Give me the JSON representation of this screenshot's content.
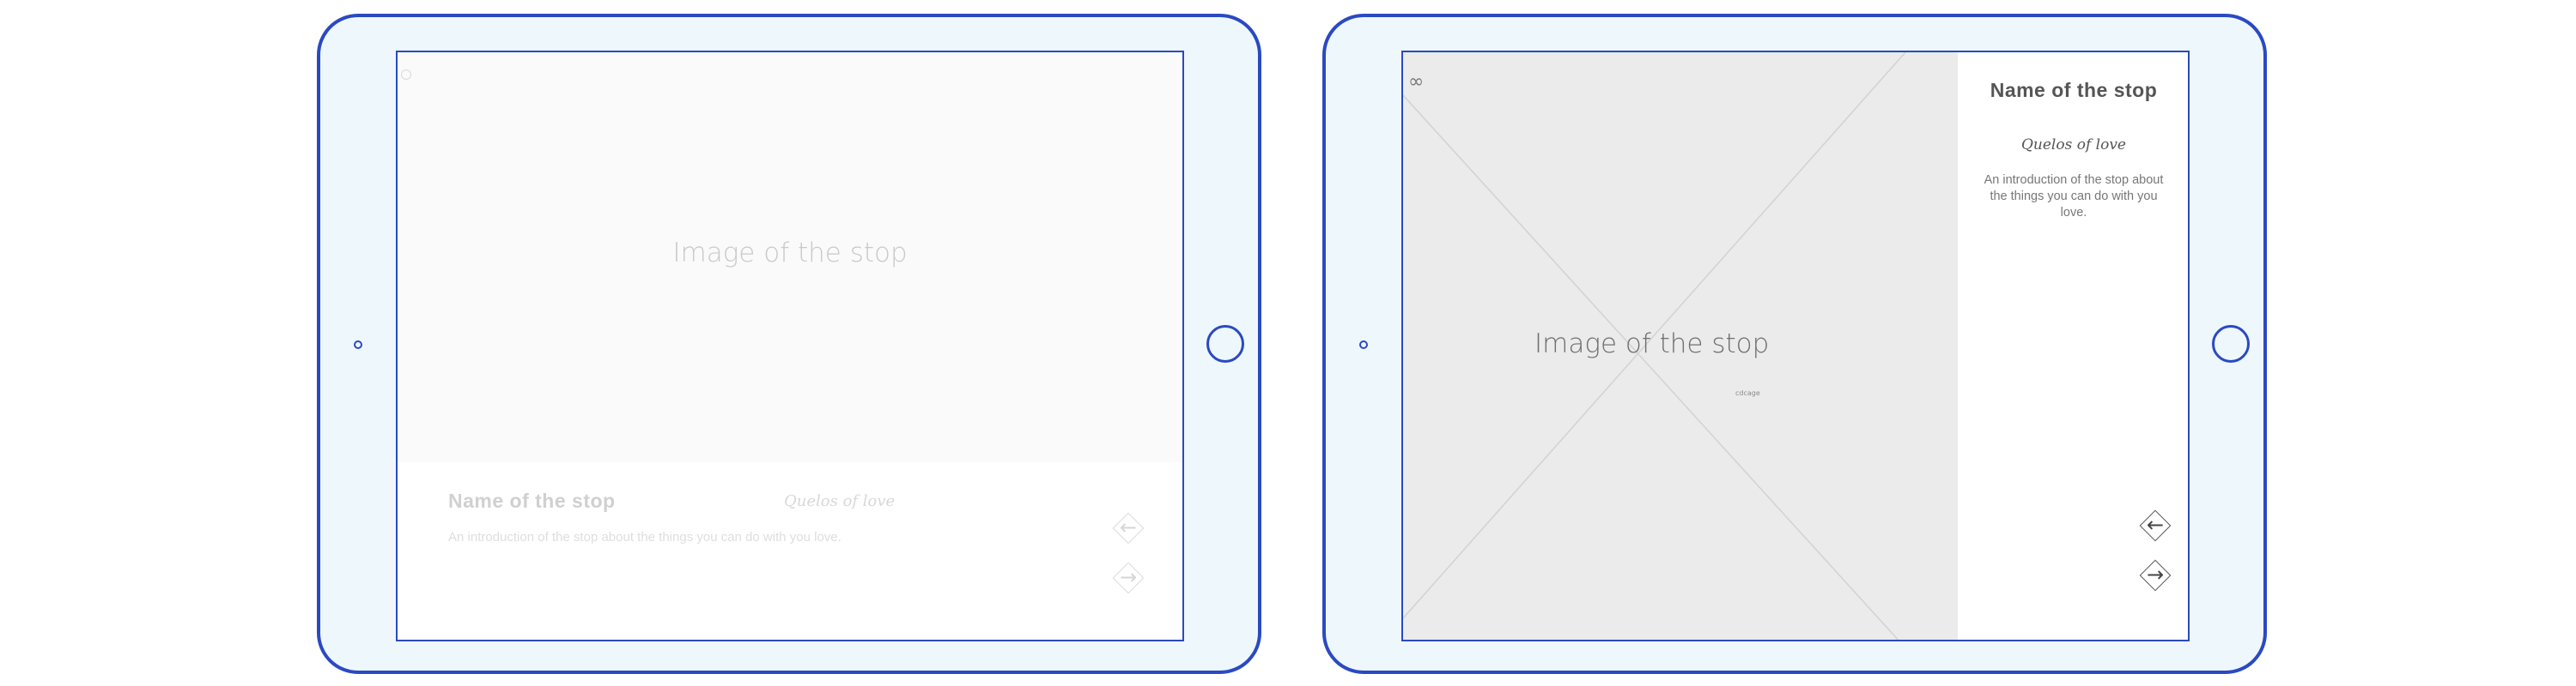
{
  "left_tablet": {
    "image_placeholder": "Image of the stop",
    "stop_name": "Name of the stop",
    "script_tagline": "Quelos of love",
    "intro": "An introduction of the stop about the things you can do with you love.",
    "prev_arrow": "←",
    "next_arrow": "→"
  },
  "right_tablet": {
    "logo_glyph": "∞",
    "image_placeholder": "Image of the stop",
    "image_caption": "cdcage",
    "stop_name": "Name of the stop",
    "script_tagline": "Quelos of love",
    "intro": "An introduction of the stop about the things you can do with you love.",
    "prev_arrow": "←",
    "next_arrow": "→"
  },
  "colors": {
    "device_outline": "#2b49c2",
    "device_fill": "#eef7fc",
    "image_placeholder_bg": "#ebebeb"
  }
}
